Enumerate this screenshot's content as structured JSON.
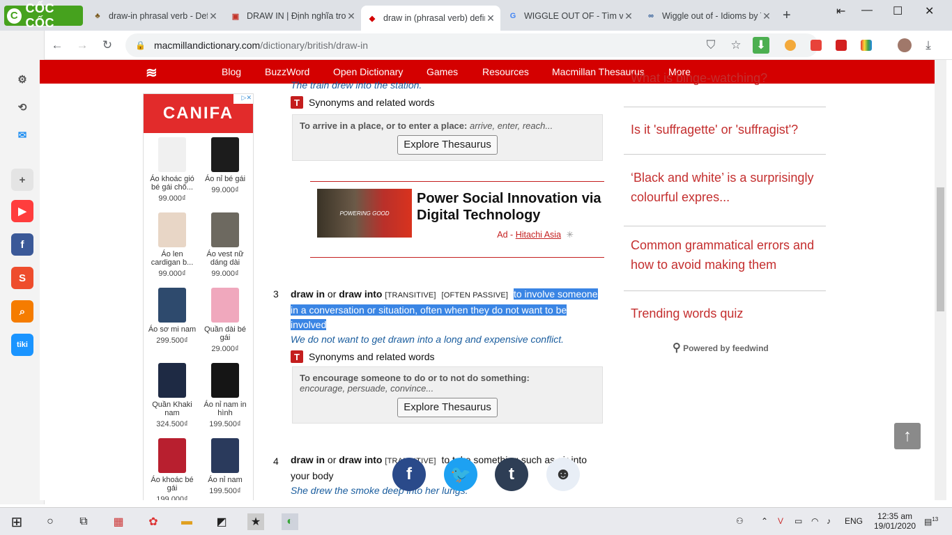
{
  "browser": {
    "brand": "CỐC CỐC",
    "tabs": [
      {
        "title": "draw-in phrasal verb - Defi",
        "icon": "bird-favicon-icon"
      },
      {
        "title": "DRAW IN | Định nghĩa tron",
        "icon": "cambridge-favicon-icon"
      },
      {
        "title": "draw in (phrasal verb) defin",
        "icon": "macmillan-favicon-icon",
        "active": true
      },
      {
        "title": "WIGGLE OUT OF - Tìm với",
        "icon": "google-favicon-icon"
      },
      {
        "title": "Wiggle out of - Idioms by T",
        "icon": "idioms-favicon-icon"
      }
    ],
    "url_host": "macmillandictionary.com",
    "url_path": "/dictionary/british/draw-in"
  },
  "site_nav": {
    "items": [
      "Blog",
      "BuzzWord",
      "Open Dictionary",
      "Games",
      "Resources",
      "Macmillan Thesaurus",
      "More"
    ]
  },
  "ad": {
    "brand": "CANIFA",
    "products": [
      {
        "name": "Áo khoác gió bé gái chố...",
        "price": "99.000₫",
        "color": "#f0f0f0"
      },
      {
        "name": "Áo nỉ bé gái",
        "price": "99.000₫",
        "color": "#1c1c1c"
      },
      {
        "name": "Áo len cardigan b...",
        "price": "99.000₫",
        "color": "#e8d6c6"
      },
      {
        "name": "Áo vest nữ dáng dài",
        "price": "99.000₫",
        "color": "#6d6960"
      },
      {
        "name": "Áo sơ mi nam",
        "price": "299.500₫",
        "color": "#2e4a6d"
      },
      {
        "name": "Quần dài bé gái",
        "price": "29.000₫",
        "color": "#f0a8bd"
      },
      {
        "name": "Quần Khaki nam",
        "price": "324.500₫",
        "color": "#1e2a44"
      },
      {
        "name": "Áo nỉ nam in hình",
        "price": "199.500₫",
        "color": "#151515"
      },
      {
        "name": "Áo khoác bé gái",
        "price": "199.000₫",
        "color": "#b81f2f"
      },
      {
        "name": "Áo nỉ nam",
        "price": "199.500₫",
        "color": "#2a3a5c"
      }
    ]
  },
  "entry": {
    "example_top": "The train drew into the station.",
    "syn_label": "Synonyms and related words",
    "thes1_def": "To arrive in a place, or to enter a place:",
    "thes1_words": "arrive, enter, reach...",
    "thes_button": "Explore Thesaurus",
    "promo_title": "Power Social Innovation via Digital Technology",
    "promo_ad_prefix": "Ad -",
    "promo_advertiser": "Hitachi Asia",
    "promo_image_text": "POWERING GOOD",
    "sense3": {
      "num": "3",
      "head1": "draw in",
      "or": "or",
      "head2": "draw into",
      "gram1": "[TRANSITIVE]",
      "gram2": "[OFTEN PASSIVE]",
      "def": "to involve someone in a conversation or situation, often when they do not want to be involved",
      "example": "We do not want to get drawn into a long and expensive conflict."
    },
    "thes2_def": "To encourage someone to do or to not do something:",
    "thes2_words": "encourage, persuade, convince...",
    "sense4": {
      "num": "4",
      "head1": "draw in",
      "or": "or",
      "head2": "draw into",
      "gram1": "[TRANSITIVE]",
      "def": "to take something such as air into your body",
      "example": "She drew the smoke deep into her lungs."
    }
  },
  "sidebar_links": [
    "What is binge-watching?",
    "Is it 'suffragette' or 'suffragist'?",
    "‘Black and white’ is a surprisingly colourful expres...",
    "Common grammatical errors and how to avoid making them",
    "Trending words quiz"
  ],
  "feedwind": "Powered by feedwind",
  "taskbar": {
    "lang": "ENG",
    "time": "12:35 am",
    "date": "19/01/2020",
    "notif_count": "13"
  }
}
